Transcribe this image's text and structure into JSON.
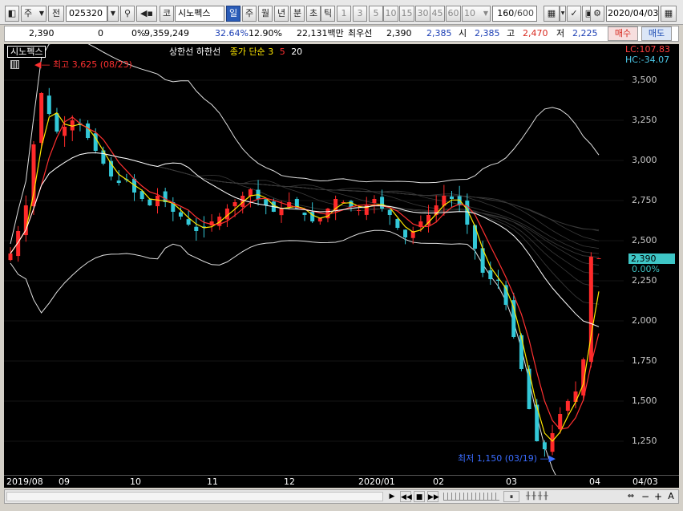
{
  "toolbar": {
    "type_select": "주",
    "prev_label": "전",
    "code_value": "025320",
    "kr_badge": "코",
    "name_value": "시노펙스",
    "period_tabs": [
      "일",
      "주",
      "월",
      "년",
      "분",
      "초",
      "틱"
    ],
    "selected_period": "일",
    "interval_buttons": [
      "1",
      "3",
      "5",
      "10",
      "15",
      "30",
      "45",
      "60"
    ],
    "interval_select": "10",
    "count_value": "160",
    "count_total": "/600",
    "date_value": "2020/04/03"
  },
  "quote": {
    "price": "2,390",
    "change": "0",
    "change_pct": "0%",
    "volume": "9,359,249",
    "turnover_pct": "32.64%",
    "ratio_pct": "12.90%",
    "amount": "22,131백만",
    "best_label": "최우선",
    "best_value": "2,390",
    "bid_value": "2,385",
    "open_label": "시",
    "open_value": "2,385",
    "high_label": "고",
    "high_value": "2,470",
    "low_label": "저",
    "low_value": "2,225",
    "buy_label": "매수",
    "sell_label": "매도"
  },
  "legend": {
    "name": "시노펙스",
    "envelope": "상한선 하한선",
    "ma_label": "종가 단순",
    "ma_periods": [
      "3",
      "5",
      "20"
    ]
  },
  "right_axis": {
    "lc": "LC:107.83",
    "hc": "HC:-34.07",
    "current_price": "2,390",
    "current_change": "0.00%"
  },
  "annotations": {
    "high": "최고 3,625 (08/23)",
    "low": "최저 1,150 (03/19)"
  },
  "colors": {
    "up": "#ff2a2a",
    "down": "#33c8d8",
    "ma3": "#ffe800",
    "ma5": "#ff3030",
    "ma20": "#ffffff",
    "selected_tab": "#2a5cb8",
    "buy": "#d8281e",
    "sell": "#1f4fb4"
  },
  "chart_data": {
    "type": "candlestick",
    "title": "시노펙스",
    "y_ticks": [
      3500,
      3250,
      3000,
      2750,
      2500,
      2250,
      2000,
      1750,
      1500,
      1250
    ],
    "ylim": [
      1090,
      3700
    ],
    "x_labels": [
      "2019/08",
      "09",
      "10",
      "11",
      "12",
      "2020/01",
      "02",
      "03",
      "04",
      "04/03"
    ],
    "series_close": [
      2420,
      2560,
      2720,
      3100,
      3420,
      3290,
      3180,
      3210,
      3250,
      3220,
      3140,
      3060,
      2980,
      2900,
      2860,
      2880,
      2800,
      2760,
      2720,
      2780,
      2740,
      2680,
      2650,
      2600,
      2560,
      2580,
      2620,
      2650,
      2700,
      2740,
      2780,
      2820,
      2760,
      2720,
      2680,
      2700,
      2740,
      2700,
      2660,
      2620,
      2640,
      2700,
      2760,
      2740,
      2710,
      2690,
      2720,
      2760,
      2700,
      2660,
      2580,
      2520,
      2560,
      2620,
      2660,
      2720,
      2780,
      2760,
      2720,
      2600,
      2450,
      2300,
      2260,
      2250,
      2100,
      1900,
      1700,
      1450,
      1250,
      1200,
      1300,
      1420,
      1500,
      1560,
      1760,
      2400,
      2390
    ],
    "annotations": {
      "high": 3625,
      "high_date": "08/23",
      "low": 1150,
      "low_date": "03/19"
    },
    "current": 2390
  }
}
